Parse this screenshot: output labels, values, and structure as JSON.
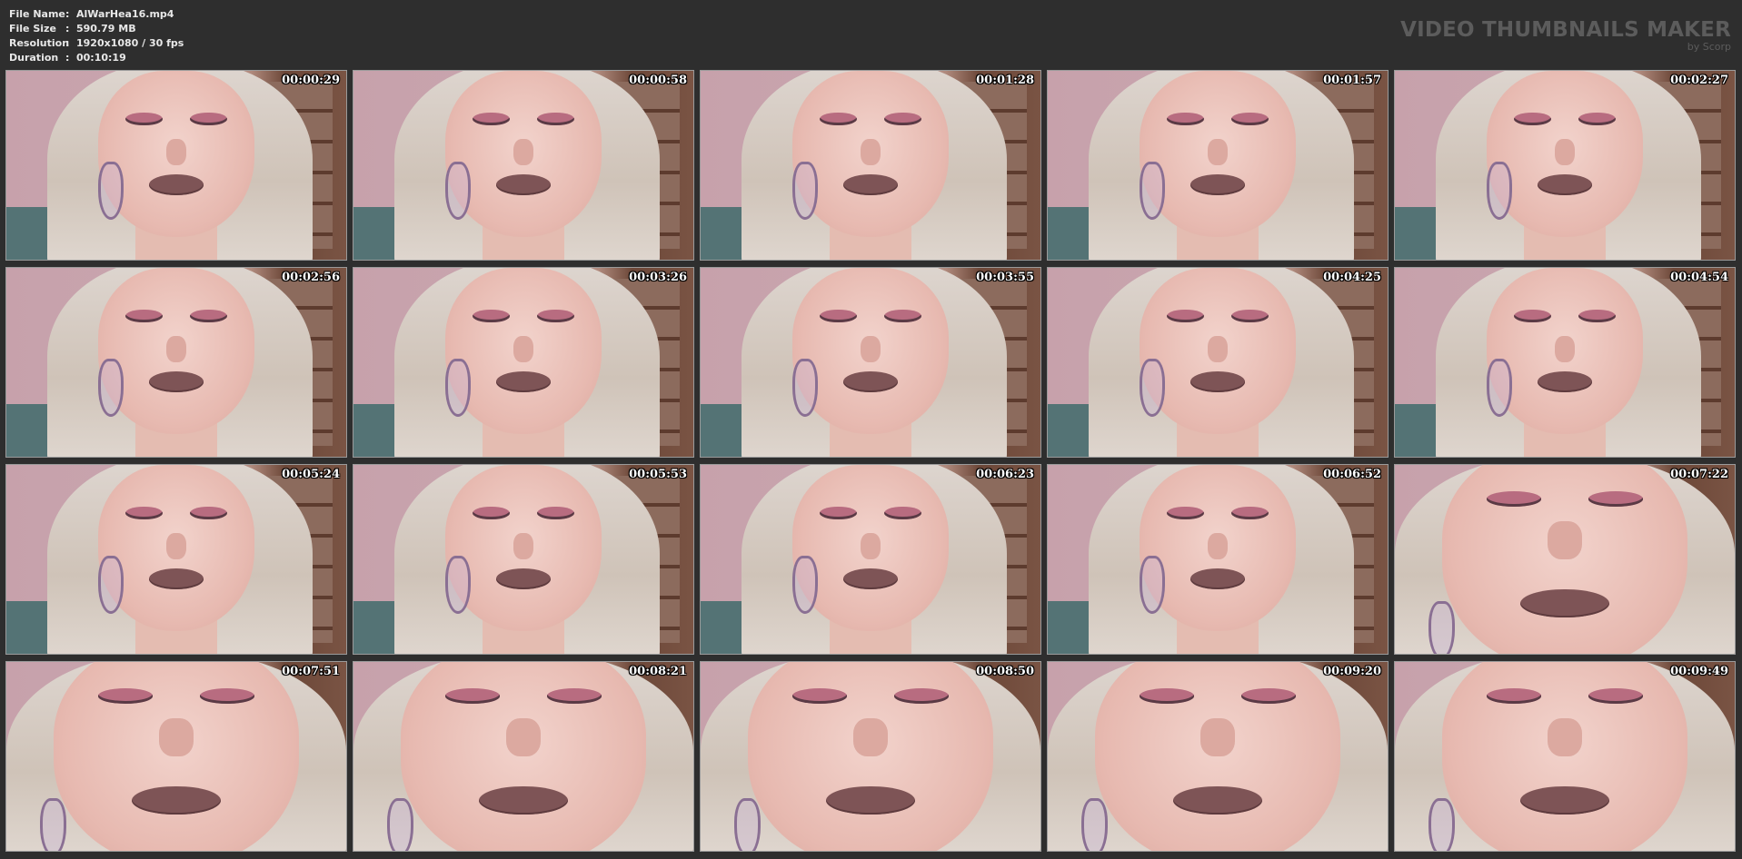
{
  "file_info": {
    "rows": [
      {
        "label": "File Name",
        "sep": ":",
        "value": "AlWarHea16.mp4"
      },
      {
        "label": "File Size",
        "sep": ":",
        "value": "590.79 MB"
      },
      {
        "label": "Resolution",
        "sep": ":",
        "value": "1920x1080 / 30 fps"
      },
      {
        "label": "Duration",
        "sep": ":",
        "value": "00:10:19"
      }
    ]
  },
  "brand": {
    "title": "VIDEO THUMBNAILS MAKER",
    "subtitle": "by Scorp"
  },
  "thumbnails": [
    {
      "timestamp": "00:00:29",
      "shot": "medium"
    },
    {
      "timestamp": "00:00:58",
      "shot": "medium"
    },
    {
      "timestamp": "00:01:28",
      "shot": "medium"
    },
    {
      "timestamp": "00:01:57",
      "shot": "medium"
    },
    {
      "timestamp": "00:02:27",
      "shot": "medium"
    },
    {
      "timestamp": "00:02:56",
      "shot": "medium"
    },
    {
      "timestamp": "00:03:26",
      "shot": "medium"
    },
    {
      "timestamp": "00:03:55",
      "shot": "medium"
    },
    {
      "timestamp": "00:04:25",
      "shot": "medium"
    },
    {
      "timestamp": "00:04:54",
      "shot": "medium"
    },
    {
      "timestamp": "00:05:24",
      "shot": "medium"
    },
    {
      "timestamp": "00:05:53",
      "shot": "medium"
    },
    {
      "timestamp": "00:06:23",
      "shot": "medium"
    },
    {
      "timestamp": "00:06:52",
      "shot": "medium"
    },
    {
      "timestamp": "00:07:22",
      "shot": "close"
    },
    {
      "timestamp": "00:07:51",
      "shot": "close"
    },
    {
      "timestamp": "00:08:21",
      "shot": "close"
    },
    {
      "timestamp": "00:08:50",
      "shot": "close"
    },
    {
      "timestamp": "00:09:20",
      "shot": "close"
    },
    {
      "timestamp": "00:09:49",
      "shot": "close"
    }
  ],
  "colors": {
    "background": "#2e2e2e",
    "info_text": "#e8e8e8",
    "brand_text": "#5c5c5c",
    "thumb_border": "#9a9a9a"
  }
}
